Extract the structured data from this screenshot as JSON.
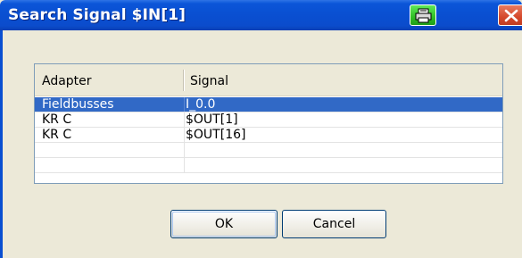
{
  "dialog": {
    "title": "Search Signal $IN[1]",
    "icons": {
      "print": "printer-icon",
      "close": "close-icon"
    }
  },
  "table": {
    "columns": [
      "Adapter",
      "Signal"
    ],
    "rows": [
      {
        "adapter": "Fieldbusses",
        "signal": "I_0.0",
        "selected": true
      },
      {
        "adapter": "KR C",
        "signal": "$OUT[1]",
        "selected": false
      },
      {
        "adapter": "KR C",
        "signal": "$OUT[16]",
        "selected": false
      }
    ]
  },
  "buttons": {
    "ok": "OK",
    "cancel": "Cancel"
  },
  "colors": {
    "title_bar": "#0a4fd1",
    "selection": "#3169c6",
    "dialog_bg": "#ece9d8",
    "print_button": "#2fbf24",
    "close_button": "#d5482b"
  }
}
